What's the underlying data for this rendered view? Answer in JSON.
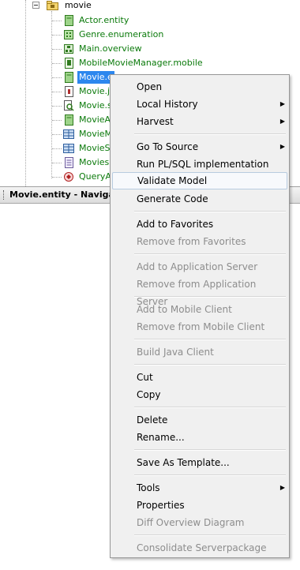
{
  "tree": {
    "root": {
      "label": "movie",
      "icon": "package-folder-icon"
    },
    "items": [
      {
        "label": "Actor.entity",
        "icon": "entity-file-icon",
        "color": "#0b7a0b"
      },
      {
        "label": "Genre.enumeration",
        "icon": "enumeration-icon",
        "color": "#0b7a0b"
      },
      {
        "label": "Main.overview",
        "icon": "overview-icon",
        "color": "#0b7a0b"
      },
      {
        "label": "MobileMovieManager.mobile",
        "icon": "mobile-file-icon",
        "color": "#0b7a0b"
      },
      {
        "label": "Movie.e",
        "icon": "entity-file-icon",
        "color": "#0b7a0b",
        "selected": true
      },
      {
        "label": "Movie.ja",
        "icon": "java-file-icon",
        "color": "#0b7a0b"
      },
      {
        "label": "Movie.s",
        "icon": "search-file-icon",
        "color": "#0b7a0b"
      },
      {
        "label": "MovieAc",
        "icon": "entity-file-icon",
        "color": "#0b7a0b"
      },
      {
        "label": "MovieMa",
        "icon": "table-icon",
        "color": "#0b7a0b"
      },
      {
        "label": "MovieSe",
        "icon": "table-icon",
        "color": "#0b7a0b"
      },
      {
        "label": "MoviesE",
        "icon": "document-icon",
        "color": "#0b7a0b"
      },
      {
        "label": "QueryA",
        "icon": "query-icon",
        "color": "#0b7a0b"
      }
    ]
  },
  "navigator": {
    "title": "Movie.entity - Navigator"
  },
  "menu": {
    "items": [
      {
        "label": "Open",
        "disabled": false
      },
      {
        "label": "Local History",
        "disabled": false,
        "submenu": true
      },
      {
        "label": "Harvest",
        "disabled": false,
        "submenu": true
      },
      {
        "label": "Go To Source",
        "disabled": false,
        "submenu": true
      },
      {
        "label": "Run PL/SQL implementation test",
        "disabled": false
      },
      {
        "label": "Validate Model",
        "disabled": false,
        "hover": true
      },
      {
        "label": "Generate Code",
        "disabled": false
      },
      {
        "label": "Add to Favorites",
        "disabled": false
      },
      {
        "label": "Remove from Favorites",
        "disabled": true
      },
      {
        "label": "Add to Application Server",
        "disabled": true
      },
      {
        "label": "Remove from Application Server",
        "disabled": true
      },
      {
        "label": "Add to Mobile Client",
        "disabled": true
      },
      {
        "label": "Remove from Mobile Client",
        "disabled": true
      },
      {
        "label": "Build Java Client",
        "disabled": true
      },
      {
        "label": "Cut",
        "disabled": false
      },
      {
        "label": "Copy",
        "disabled": false
      },
      {
        "label": "Delete",
        "disabled": false
      },
      {
        "label": "Rename...",
        "disabled": false
      },
      {
        "label": "Save As Template...",
        "disabled": false
      },
      {
        "label": "Tools",
        "disabled": false,
        "submenu": true
      },
      {
        "label": "Properties",
        "disabled": false
      },
      {
        "label": "Diff Overview Diagram",
        "disabled": true
      },
      {
        "label": "Consolidate Serverpackage",
        "disabled": true
      }
    ],
    "submenu_arrow": "▶"
  }
}
